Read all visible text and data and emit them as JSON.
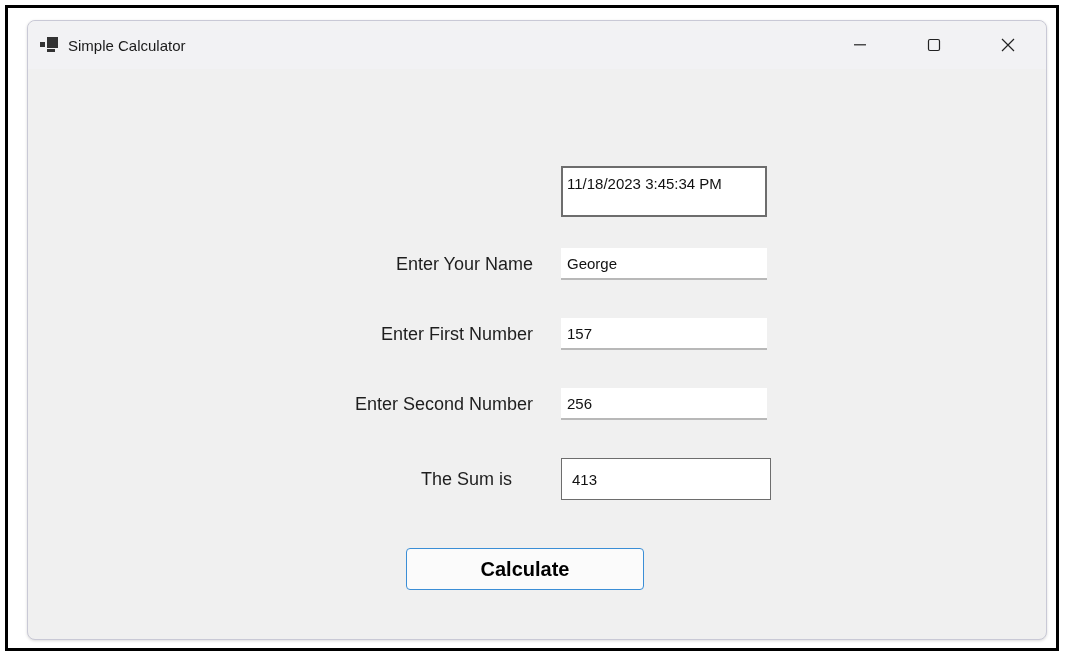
{
  "window": {
    "title": "Simple Calculator"
  },
  "fields": [
    {
      "kind": "datetime",
      "value": "11/18/2023 3:45:34 PM"
    },
    {
      "kind": "input",
      "label": "Enter Your Name",
      "value": "George"
    },
    {
      "kind": "input",
      "label": "Enter First Number",
      "value": "157"
    },
    {
      "kind": "input",
      "label": "Enter Second Number",
      "value": "256"
    },
    {
      "kind": "output",
      "label": "The Sum is",
      "value": "413"
    }
  ],
  "button": {
    "label": "Calculate"
  }
}
